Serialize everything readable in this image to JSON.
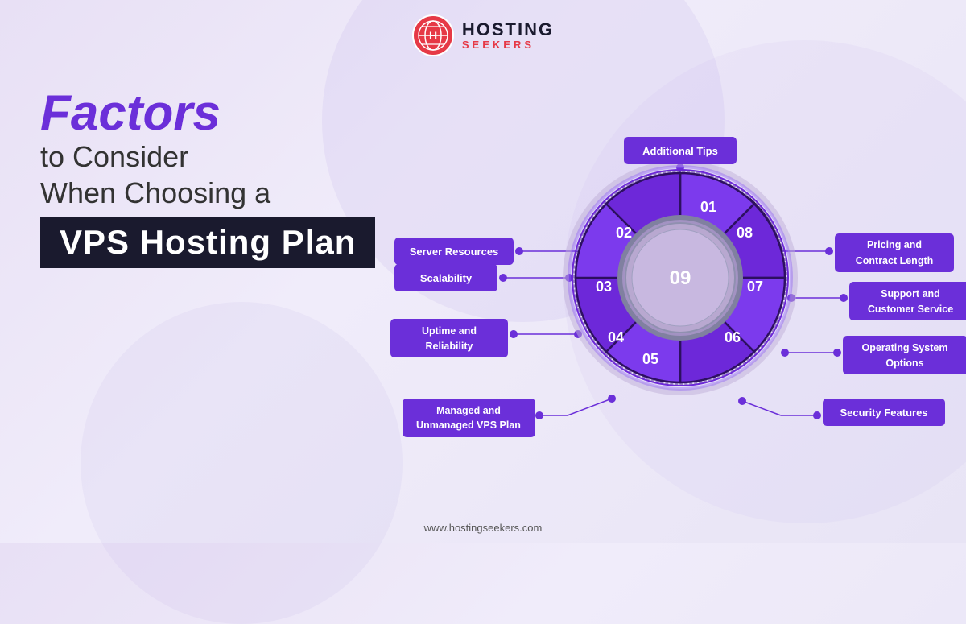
{
  "header": {
    "logo_hosting": "HOSTING",
    "logo_seekers": "SEEKERS"
  },
  "title": {
    "factors": "Factors",
    "line2": "to Consider",
    "line3": "When Choosing a",
    "vps": "VPS Hosting Plan"
  },
  "labels": {
    "additional_tips": "Additional Tips",
    "server_resources": "Server Resources",
    "pricing_contract": "Pricing and Contract Length",
    "scalability": "Scalability",
    "support_customer": "Support and Customer Service",
    "uptime_reliability": "Uptime and Reliability",
    "operating_system": "Operating System Options",
    "managed_unmanaged": "Managed and Unmanaged VPS Plan",
    "security_features": "Security Features"
  },
  "wheel": {
    "segments": [
      "01",
      "02",
      "03",
      "04",
      "05",
      "06",
      "07",
      "08"
    ],
    "center": "09"
  },
  "footer": {
    "url": "www.hostingseekers.com"
  }
}
